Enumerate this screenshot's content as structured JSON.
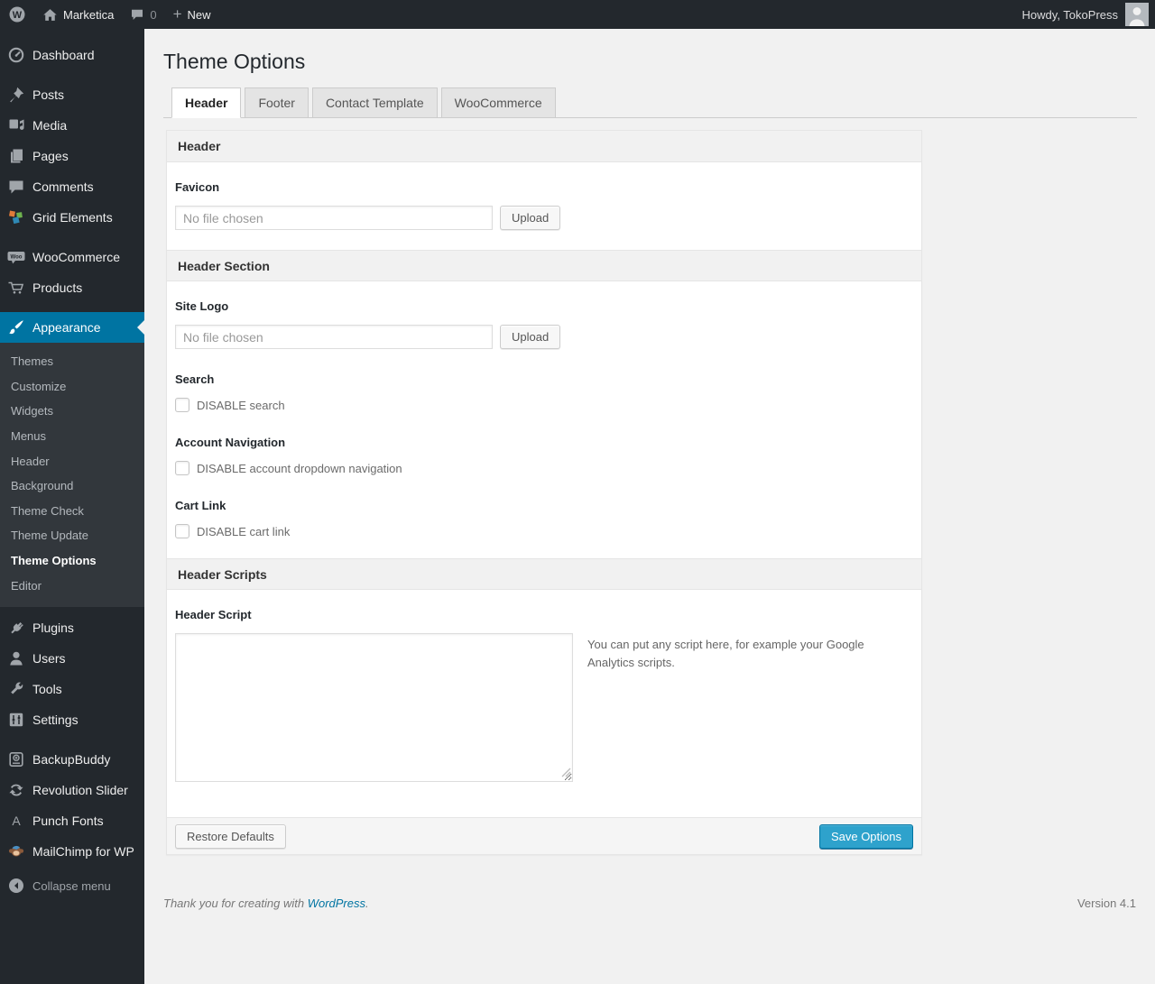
{
  "admin_bar": {
    "site_name": "Marketica",
    "comments_count": "0",
    "new_label": "New",
    "howdy_text": "Howdy, TokoPress"
  },
  "page": {
    "title": "Theme Options",
    "tabs": [
      {
        "label": "Header",
        "active": true
      },
      {
        "label": "Footer",
        "active": false
      },
      {
        "label": "Contact Template",
        "active": false
      },
      {
        "label": "WooCommerce",
        "active": false
      }
    ]
  },
  "sidebar": {
    "items": [
      {
        "label": "Dashboard",
        "icon": "dashboard-icon"
      },
      {
        "label": "Posts",
        "icon": "pushpin-icon"
      },
      {
        "label": "Media",
        "icon": "media-icon"
      },
      {
        "label": "Pages",
        "icon": "pages-icon"
      },
      {
        "label": "Comments",
        "icon": "comment-icon"
      },
      {
        "label": "Grid Elements",
        "icon": "grid-elements-icon"
      },
      {
        "label": "WooCommerce",
        "icon": "woocommerce-badge-icon"
      },
      {
        "label": "Products",
        "icon": "cart-icon"
      },
      {
        "label": "Appearance",
        "icon": "brush-icon",
        "active": true
      },
      {
        "label": "Plugins",
        "icon": "plugin-icon"
      },
      {
        "label": "Users",
        "icon": "user-icon"
      },
      {
        "label": "Tools",
        "icon": "wrench-icon"
      },
      {
        "label": "Settings",
        "icon": "settings-icon"
      },
      {
        "label": "BackupBuddy",
        "icon": "backup-icon"
      },
      {
        "label": "Revolution Slider",
        "icon": "refresh-arrows-icon"
      },
      {
        "label": "Punch Fonts",
        "icon": "letter-a-icon"
      },
      {
        "label": "MailChimp for WP",
        "icon": "monkey-icon"
      }
    ],
    "appearance_submenu": [
      "Themes",
      "Customize",
      "Widgets",
      "Menus",
      "Header",
      "Background",
      "Theme Check",
      "Theme Update",
      "Theme Options",
      "Editor"
    ],
    "current_submenu_item": "Theme Options",
    "collapse_label": "Collapse menu"
  },
  "form": {
    "section_header": "Header",
    "favicon": {
      "label": "Favicon",
      "file_placeholder": "No file chosen",
      "upload_label": "Upload"
    },
    "section_header_section": "Header Section",
    "site_logo": {
      "label": "Site Logo",
      "file_placeholder": "No file chosen",
      "upload_label": "Upload"
    },
    "search": {
      "label": "Search",
      "checkbox_label": "DISABLE search",
      "checked": false
    },
    "account_navigation": {
      "label": "Account Navigation",
      "checkbox_label": "DISABLE account dropdown navigation",
      "checked": false
    },
    "cart_link": {
      "label": "Cart Link",
      "checkbox_label": "DISABLE cart link",
      "checked": false
    },
    "section_header_scripts": "Header Scripts",
    "header_script": {
      "label": "Header Script",
      "value": "",
      "hint": "You can put any script here, for example your Google Analytics scripts."
    },
    "restore_button": "Restore Defaults",
    "save_button": "Save Options"
  },
  "footer": {
    "thanks_prefix": "Thank you for creating with ",
    "thanks_link": "WordPress",
    "thanks_suffix": ".",
    "version": "Version 4.1"
  },
  "colors": {
    "accent": "#0074a2",
    "primary_button": "#2ea2cc",
    "admin_dark": "#23282d",
    "content_background": "#f1f1f1"
  }
}
